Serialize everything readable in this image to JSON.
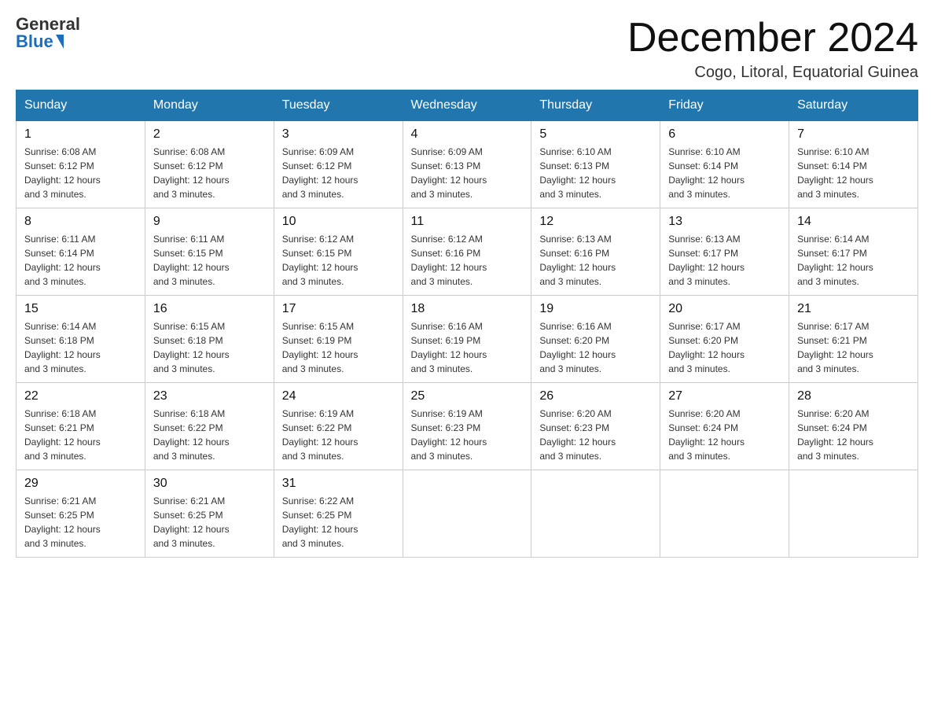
{
  "header": {
    "logo_general": "General",
    "logo_blue": "Blue",
    "title": "December 2024",
    "subtitle": "Cogo, Litoral, Equatorial Guinea"
  },
  "days_of_week": [
    "Sunday",
    "Monday",
    "Tuesday",
    "Wednesday",
    "Thursday",
    "Friday",
    "Saturday"
  ],
  "weeks": [
    [
      {
        "day": "1",
        "sunrise": "6:08 AM",
        "sunset": "6:12 PM",
        "daylight": "12 hours and 3 minutes."
      },
      {
        "day": "2",
        "sunrise": "6:08 AM",
        "sunset": "6:12 PM",
        "daylight": "12 hours and 3 minutes."
      },
      {
        "day": "3",
        "sunrise": "6:09 AM",
        "sunset": "6:12 PM",
        "daylight": "12 hours and 3 minutes."
      },
      {
        "day": "4",
        "sunrise": "6:09 AM",
        "sunset": "6:13 PM",
        "daylight": "12 hours and 3 minutes."
      },
      {
        "day": "5",
        "sunrise": "6:10 AM",
        "sunset": "6:13 PM",
        "daylight": "12 hours and 3 minutes."
      },
      {
        "day": "6",
        "sunrise": "6:10 AM",
        "sunset": "6:14 PM",
        "daylight": "12 hours and 3 minutes."
      },
      {
        "day": "7",
        "sunrise": "6:10 AM",
        "sunset": "6:14 PM",
        "daylight": "12 hours and 3 minutes."
      }
    ],
    [
      {
        "day": "8",
        "sunrise": "6:11 AM",
        "sunset": "6:14 PM",
        "daylight": "12 hours and 3 minutes."
      },
      {
        "day": "9",
        "sunrise": "6:11 AM",
        "sunset": "6:15 PM",
        "daylight": "12 hours and 3 minutes."
      },
      {
        "day": "10",
        "sunrise": "6:12 AM",
        "sunset": "6:15 PM",
        "daylight": "12 hours and 3 minutes."
      },
      {
        "day": "11",
        "sunrise": "6:12 AM",
        "sunset": "6:16 PM",
        "daylight": "12 hours and 3 minutes."
      },
      {
        "day": "12",
        "sunrise": "6:13 AM",
        "sunset": "6:16 PM",
        "daylight": "12 hours and 3 minutes."
      },
      {
        "day": "13",
        "sunrise": "6:13 AM",
        "sunset": "6:17 PM",
        "daylight": "12 hours and 3 minutes."
      },
      {
        "day": "14",
        "sunrise": "6:14 AM",
        "sunset": "6:17 PM",
        "daylight": "12 hours and 3 minutes."
      }
    ],
    [
      {
        "day": "15",
        "sunrise": "6:14 AM",
        "sunset": "6:18 PM",
        "daylight": "12 hours and 3 minutes."
      },
      {
        "day": "16",
        "sunrise": "6:15 AM",
        "sunset": "6:18 PM",
        "daylight": "12 hours and 3 minutes."
      },
      {
        "day": "17",
        "sunrise": "6:15 AM",
        "sunset": "6:19 PM",
        "daylight": "12 hours and 3 minutes."
      },
      {
        "day": "18",
        "sunrise": "6:16 AM",
        "sunset": "6:19 PM",
        "daylight": "12 hours and 3 minutes."
      },
      {
        "day": "19",
        "sunrise": "6:16 AM",
        "sunset": "6:20 PM",
        "daylight": "12 hours and 3 minutes."
      },
      {
        "day": "20",
        "sunrise": "6:17 AM",
        "sunset": "6:20 PM",
        "daylight": "12 hours and 3 minutes."
      },
      {
        "day": "21",
        "sunrise": "6:17 AM",
        "sunset": "6:21 PM",
        "daylight": "12 hours and 3 minutes."
      }
    ],
    [
      {
        "day": "22",
        "sunrise": "6:18 AM",
        "sunset": "6:21 PM",
        "daylight": "12 hours and 3 minutes."
      },
      {
        "day": "23",
        "sunrise": "6:18 AM",
        "sunset": "6:22 PM",
        "daylight": "12 hours and 3 minutes."
      },
      {
        "day": "24",
        "sunrise": "6:19 AM",
        "sunset": "6:22 PM",
        "daylight": "12 hours and 3 minutes."
      },
      {
        "day": "25",
        "sunrise": "6:19 AM",
        "sunset": "6:23 PM",
        "daylight": "12 hours and 3 minutes."
      },
      {
        "day": "26",
        "sunrise": "6:20 AM",
        "sunset": "6:23 PM",
        "daylight": "12 hours and 3 minutes."
      },
      {
        "day": "27",
        "sunrise": "6:20 AM",
        "sunset": "6:24 PM",
        "daylight": "12 hours and 3 minutes."
      },
      {
        "day": "28",
        "sunrise": "6:20 AM",
        "sunset": "6:24 PM",
        "daylight": "12 hours and 3 minutes."
      }
    ],
    [
      {
        "day": "29",
        "sunrise": "6:21 AM",
        "sunset": "6:25 PM",
        "daylight": "12 hours and 3 minutes."
      },
      {
        "day": "30",
        "sunrise": "6:21 AM",
        "sunset": "6:25 PM",
        "daylight": "12 hours and 3 minutes."
      },
      {
        "day": "31",
        "sunrise": "6:22 AM",
        "sunset": "6:25 PM",
        "daylight": "12 hours and 3 minutes."
      },
      null,
      null,
      null,
      null
    ]
  ],
  "labels": {
    "sunrise": "Sunrise:",
    "sunset": "Sunset:",
    "daylight": "Daylight:"
  }
}
